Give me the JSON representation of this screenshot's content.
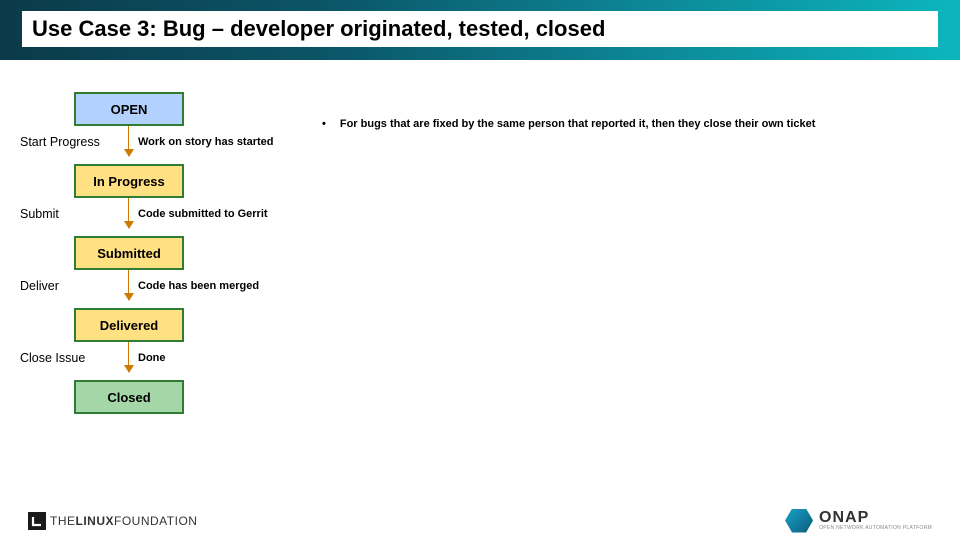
{
  "title": "Use Case 3: Bug – developer originated, tested, closed",
  "states": {
    "open": "OPEN",
    "in_progress": "In Progress",
    "submitted": "Submitted",
    "delivered": "Delivered",
    "closed": "Closed"
  },
  "actions": {
    "start_progress": "Start Progress",
    "submit": "Submit",
    "deliver": "Deliver",
    "close_issue": "Close Issue"
  },
  "descriptions": {
    "start_progress": "Work on story has started",
    "submit": "Code submitted to Gerrit",
    "deliver": "Code has been merged",
    "close_issue": "Done"
  },
  "bullet": "For bugs that are fixed by the same person that reported it, then they close their own ticket",
  "footer": {
    "linux_foundation_prefix": "THE",
    "linux_foundation_mid": "LINUX",
    "linux_foundation_suffix": "FOUNDATION",
    "onap_main": "ONAP",
    "onap_sub": "OPEN NETWORK AUTOMATION PLATFORM"
  }
}
